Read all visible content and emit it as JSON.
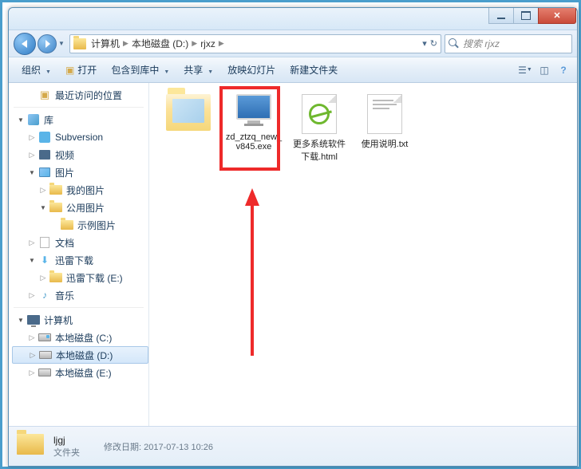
{
  "titlebar": {
    "min": "",
    "max": "",
    "close": ""
  },
  "address": {
    "crumbs": [
      "计算机",
      "本地磁盘 (D:)",
      "rjxz"
    ],
    "search_placeholder": "搜索 rjxz"
  },
  "toolbar": {
    "organize": "组织",
    "open": "打开",
    "include": "包含到库中",
    "share": "共享",
    "slideshow": "放映幻灯片",
    "newfolder": "新建文件夹"
  },
  "sidebar": {
    "recent": "最近访问的位置",
    "libraries": "库",
    "subversion": "Subversion",
    "video": "视频",
    "pictures": "图片",
    "mypics": "我的图片",
    "publicpics": "公用图片",
    "samplepics": "示例图片",
    "docs": "文档",
    "thunder": "迅雷下载",
    "thunder_e": "迅雷下载 (E:)",
    "music": "音乐",
    "computer": "计算机",
    "drive_c": "本地磁盘 (C:)",
    "drive_d": "本地磁盘 (D:)",
    "drive_e": "本地磁盘 (E:)"
  },
  "files": {
    "folder1": "ljgj",
    "exe": "zd_ztzq_new_v845.exe",
    "html": "更多系统软件下载.html",
    "txt": "使用说明.txt"
  },
  "details": {
    "name": "ljgj",
    "type": "文件夹",
    "modlabel": "修改日期:",
    "moddate": "2017-07-13 10:26"
  }
}
